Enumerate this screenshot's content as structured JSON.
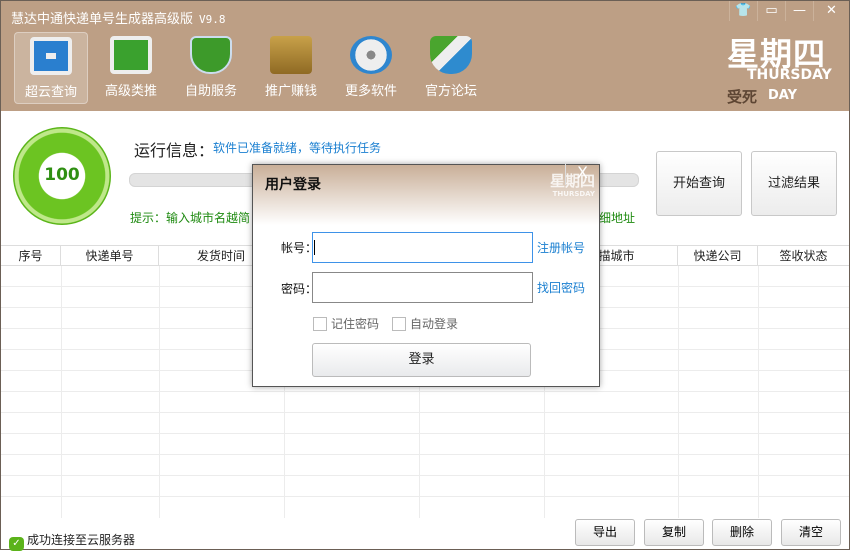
{
  "app": {
    "title": "慧达中通快递单号生成器高级版",
    "version": "V9.8"
  },
  "window_buttons": [
    {
      "icon": "skin-icon",
      "glyph": "👕"
    },
    {
      "icon": "menu-icon",
      "glyph": "▭"
    },
    {
      "icon": "minimize-icon",
      "glyph": "—"
    },
    {
      "icon": "close-icon",
      "glyph": "✕"
    }
  ],
  "toolbar": [
    {
      "label": "超云查询",
      "icon": "monitor-chart-icon",
      "active": true
    },
    {
      "label": "高级类推",
      "icon": "monitor-wand-icon"
    },
    {
      "label": "自助服务",
      "icon": "shield-clock-icon"
    },
    {
      "label": "推广赚钱",
      "icon": "briefcase-icon"
    },
    {
      "label": "更多软件",
      "icon": "disc-icon"
    },
    {
      "label": "官方论坛",
      "icon": "shield-icon"
    }
  ],
  "logo": {
    "cn": "星期四",
    "en": "THURSDAY",
    "cn2": "受死",
    "day": "DAY"
  },
  "gauge": {
    "value": "100",
    "color": "#6cc422"
  },
  "run": {
    "label": "运行信息：",
    "message": "软件已准备就绪，等待执行任务",
    "progress": 0
  },
  "hint": {
    "part1": "提示：输入城市名越简",
    "part2": "细地址"
  },
  "actions": {
    "start": "开始查询",
    "filter": "过滤结果"
  },
  "table": {
    "columns": [
      "序号",
      "快递单号",
      "发货时间",
      "",
      "",
      "扫描城市",
      "快递公司",
      "签收状态"
    ],
    "rows": []
  },
  "status": {
    "text": "成功连接至云服务器"
  },
  "bottom_buttons": [
    "导出",
    "复制",
    "删除",
    "清空"
  ],
  "dialog": {
    "title": "用户登录",
    "close": "X",
    "logo": "星期四",
    "logo_en": "THURSDAY",
    "account_label": "帐号：",
    "account_value": "",
    "register": "注册帐号",
    "password_label": "密码：",
    "password_value": "",
    "recover": "找回密码",
    "remember": "记住密码",
    "auto_login": "自动登录",
    "remember_checked": false,
    "auto_checked": false,
    "login": "登录"
  },
  "colors": {
    "header": "#bd9f85",
    "link": "#1a7fd0",
    "hint": "#1e8a10",
    "accent": "#3e92e8"
  }
}
